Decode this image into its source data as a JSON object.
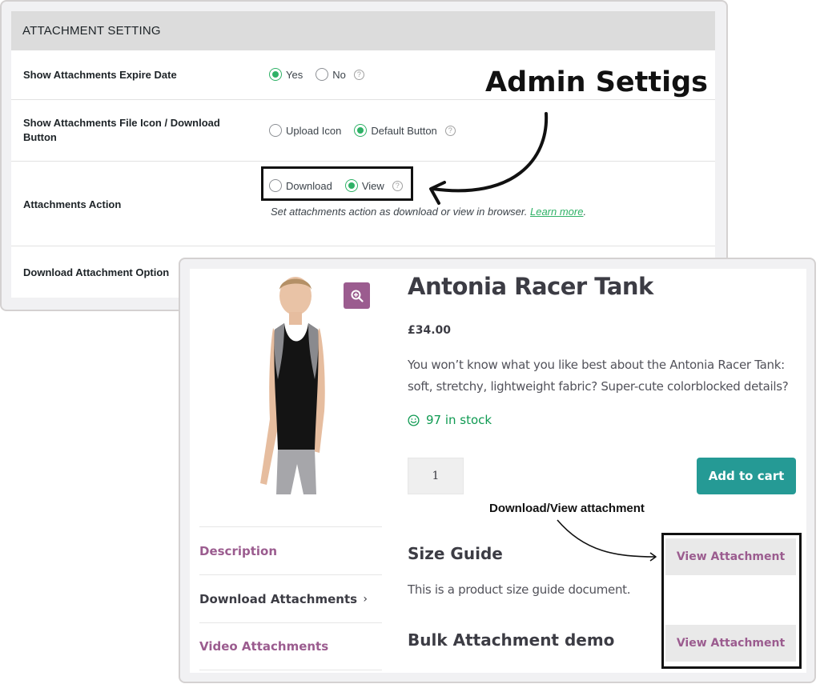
{
  "admin": {
    "header": "ATTACHMENT SETTING",
    "annotation": "Admin Settigs",
    "settings": [
      {
        "label": "Show Attachments Expire Date",
        "options": [
          {
            "label": "Yes",
            "checked": true
          },
          {
            "label": "No",
            "checked": false
          }
        ],
        "help": "?"
      },
      {
        "label": "Show Attachments File Icon / Download Button",
        "options": [
          {
            "label": "Upload Icon",
            "checked": false
          },
          {
            "label": "Default Button",
            "checked": true
          }
        ],
        "help": "?"
      },
      {
        "label": "Attachments Action",
        "options": [
          {
            "label": "Download",
            "checked": false
          },
          {
            "label": "View",
            "checked": true
          }
        ],
        "help": "?",
        "description": "Set attachments action as download or view in browser.",
        "description_link": "Learn more",
        "description_suffix": "."
      },
      {
        "label": "Download Attachment Option"
      }
    ],
    "colors": {
      "accent": "#2fb166",
      "header_bg": "#dcdcdc"
    }
  },
  "product": {
    "title": "Antonia Racer Tank",
    "price": "£34.00",
    "description": "You won’t know what you like best about the Antonia Racer Tank: soft, stretchy, lightweight fabric? Super-cute colorblocked details?",
    "stock": "97 in stock",
    "quantity": "1",
    "add_to_cart": "Add to cart",
    "zoom_icon": "zoom-in-icon",
    "tabs": [
      {
        "label": "Description",
        "active": false
      },
      {
        "label": "Download Attachments",
        "active": true,
        "chevron": "›"
      },
      {
        "label": "Video Attachments",
        "active": false
      }
    ],
    "annotation": "Download/View attachment",
    "attachments": [
      {
        "title": "Size Guide",
        "description": "This is a product size guide document.",
        "button": "View Attachment"
      },
      {
        "title": "Bulk Attachment demo",
        "button": "View Attachment"
      }
    ],
    "colors": {
      "brand": "#9b5c8f",
      "cart_button": "#259a95",
      "stock": "#0f9a52"
    }
  }
}
